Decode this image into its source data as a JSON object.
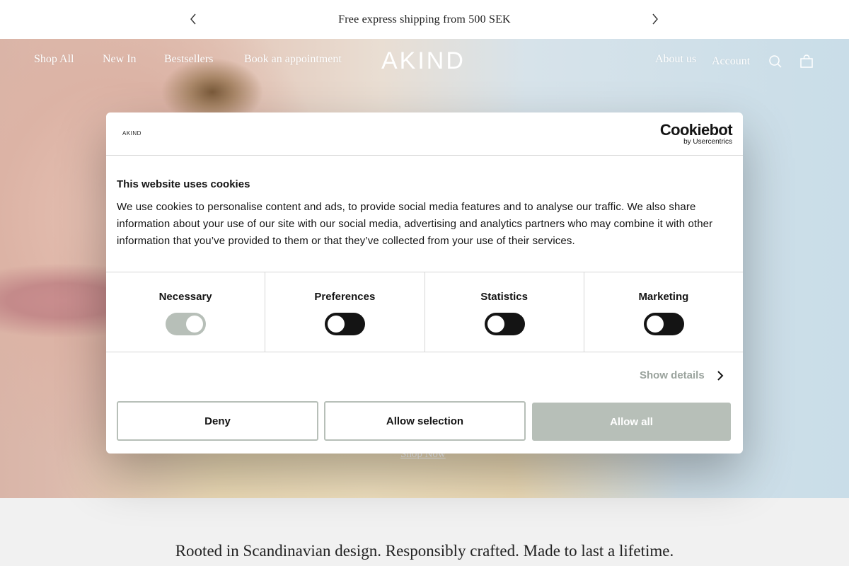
{
  "announcement": {
    "text": "Free express shipping from 500 SEK",
    "prev_icon": "chevron-left-icon",
    "next_icon": "chevron-right-icon"
  },
  "nav": {
    "left": [
      "Shop All",
      "New In",
      "Bestsellers",
      "Book an appointment"
    ],
    "logo": "AKIND",
    "right": [
      "About us",
      "Account"
    ],
    "icons": [
      "search-icon",
      "shopping-bag-icon"
    ]
  },
  "hero": {
    "cta": "Shop Now"
  },
  "tagline": "Rooted in Scandinavian design. Responsibly crafted. Made to last a lifetime.",
  "cookie_dialog": {
    "brand_small": "AKIND",
    "provider_name": "Cookiebot",
    "provider_sub": "by Usercentrics",
    "title": "This website uses cookies",
    "body": "We use cookies to personalise content and ads, to provide social media features and to analyse our traffic. We also share information about your use of our site with our social media, advertising and analytics partners who may combine it with other information that you’ve provided to them or that they’ve collected from your use of their services.",
    "categories": [
      {
        "label": "Necessary",
        "checked": true,
        "locked": true
      },
      {
        "label": "Preferences",
        "checked": false,
        "locked": false
      },
      {
        "label": "Statistics",
        "checked": false,
        "locked": false
      },
      {
        "label": "Marketing",
        "checked": false,
        "locked": false
      }
    ],
    "show_details": "Show details",
    "buttons": {
      "deny": "Deny",
      "allow_selection": "Allow selection",
      "allow_all": "Allow all"
    },
    "colors": {
      "accent": "#b7bfb8",
      "toggle_off": "#141414",
      "text": "#141414"
    }
  }
}
